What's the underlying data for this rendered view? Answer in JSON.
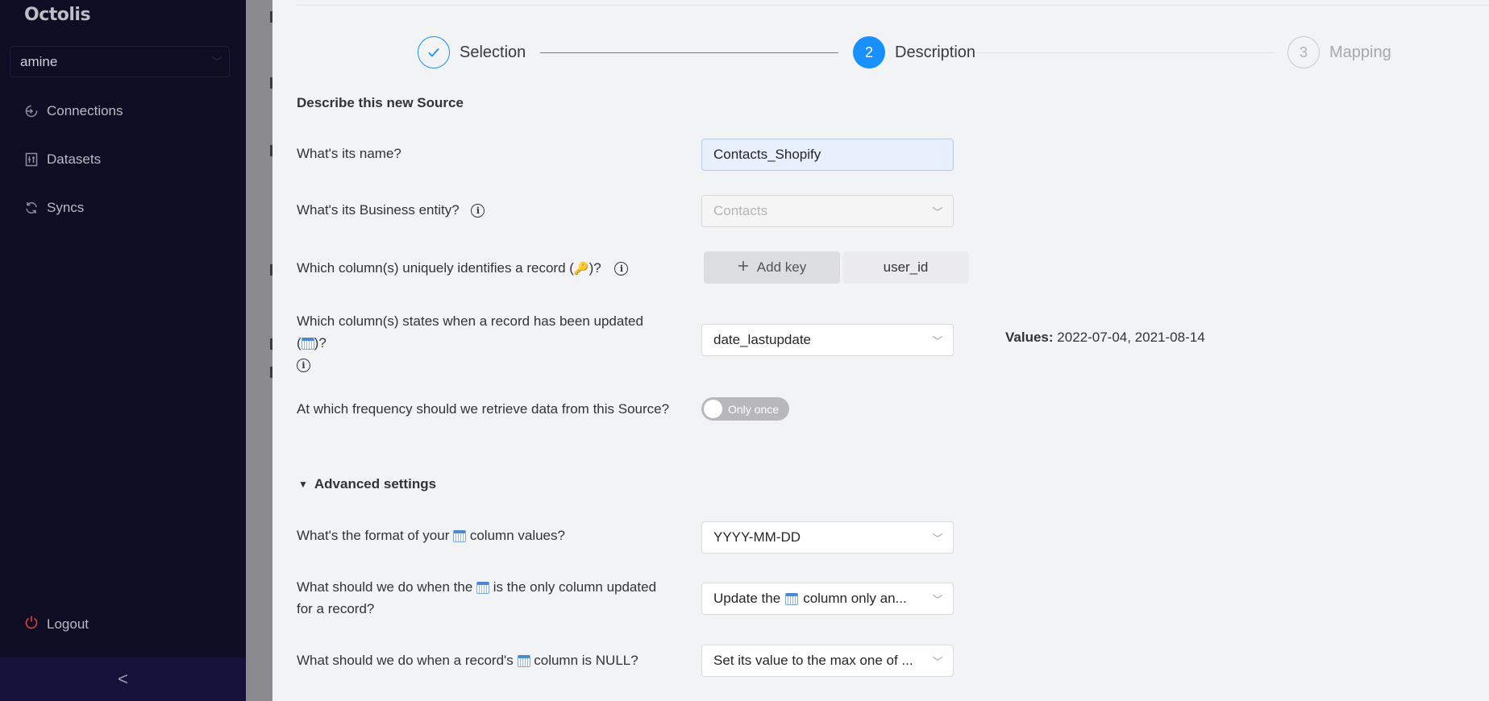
{
  "sidebar": {
    "logo": "Octolis",
    "account": "amine",
    "items": [
      {
        "label": "Connections",
        "icon": "connections-icon"
      },
      {
        "label": "Datasets",
        "icon": "datasets-icon"
      },
      {
        "label": "Syncs",
        "icon": "syncs-icon"
      }
    ],
    "logout": "Logout",
    "collapse": "<"
  },
  "stepper": {
    "steps": [
      {
        "number": "✓",
        "label": "Selection",
        "state": "done"
      },
      {
        "number": "2",
        "label": "Description",
        "state": "active"
      },
      {
        "number": "3",
        "label": "Mapping",
        "state": "pending"
      }
    ]
  },
  "form": {
    "title": "Describe this new Source",
    "name_q": "What's its name?",
    "name_value": "Contacts_Shopify",
    "entity_q": "What's its Business entity?",
    "entity_value": "Contacts",
    "key_q_pre": "Which column(s) uniquely identifies a record (",
    "key_q_post": ")?",
    "add_key": "Add key",
    "key_tag": "user_id",
    "update_q_line1": "Which column(s) states when a record has been updated",
    "update_q_pre": "(",
    "update_q_post": ")?",
    "update_value": "date_lastupdate",
    "values_label": "Values:",
    "values_text": "2022-07-04, 2021-08-14",
    "frequency_q": "At which frequency should we retrieve data from this Source?",
    "frequency_toggle": "Only once",
    "advanced": "Advanced settings",
    "format_q_pre": "What's the format of your",
    "format_q_post": "column values?",
    "format_value": "YYYY-MM-DD",
    "only_q_pre": "What should we do when the",
    "only_q_post": "is the only column updated",
    "only_q_line2": "for a record?",
    "only_value_pre": "Update the",
    "only_value_post": "column only an...",
    "null_q_pre": "What should we do when a record's",
    "null_q_post": "column is NULL?",
    "null_value": "Set its value to the max one of ..."
  },
  "colors": {
    "sidebar_bg": "#0f0d24",
    "accent": "#1890ff",
    "logout": "#e0413a"
  }
}
